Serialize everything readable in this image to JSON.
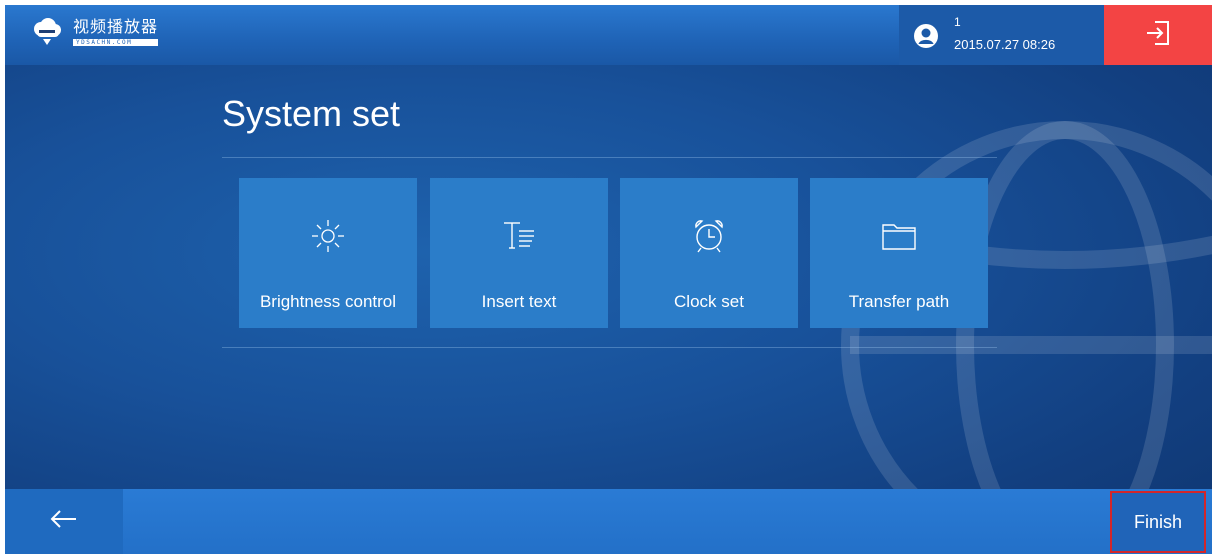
{
  "header": {
    "app_title": "视频播放器",
    "logo_subtext": "YDSACHN.COM",
    "logo_icon": "cloud-logo-icon",
    "user": {
      "number": "1",
      "datetime": "2015.07.27 08:26",
      "icon": "user-icon"
    },
    "exit_icon": "exit-icon",
    "exit_color": "#f34444"
  },
  "main": {
    "title": "System set",
    "tiles": [
      {
        "label": "Brightness control",
        "icon": "brightness-icon"
      },
      {
        "label": "Insert text",
        "icon": "insert-text-icon"
      },
      {
        "label": "Clock set",
        "icon": "alarm-clock-icon"
      },
      {
        "label": "Transfer path",
        "icon": "folder-icon"
      }
    ]
  },
  "footer": {
    "back_icon": "back-arrow-icon",
    "finish_label": "Finish"
  },
  "colors": {
    "background": "#18519a",
    "tile": "#2b7dc9",
    "topbar": "#1f63b6",
    "finish_border": "#d2262a"
  }
}
